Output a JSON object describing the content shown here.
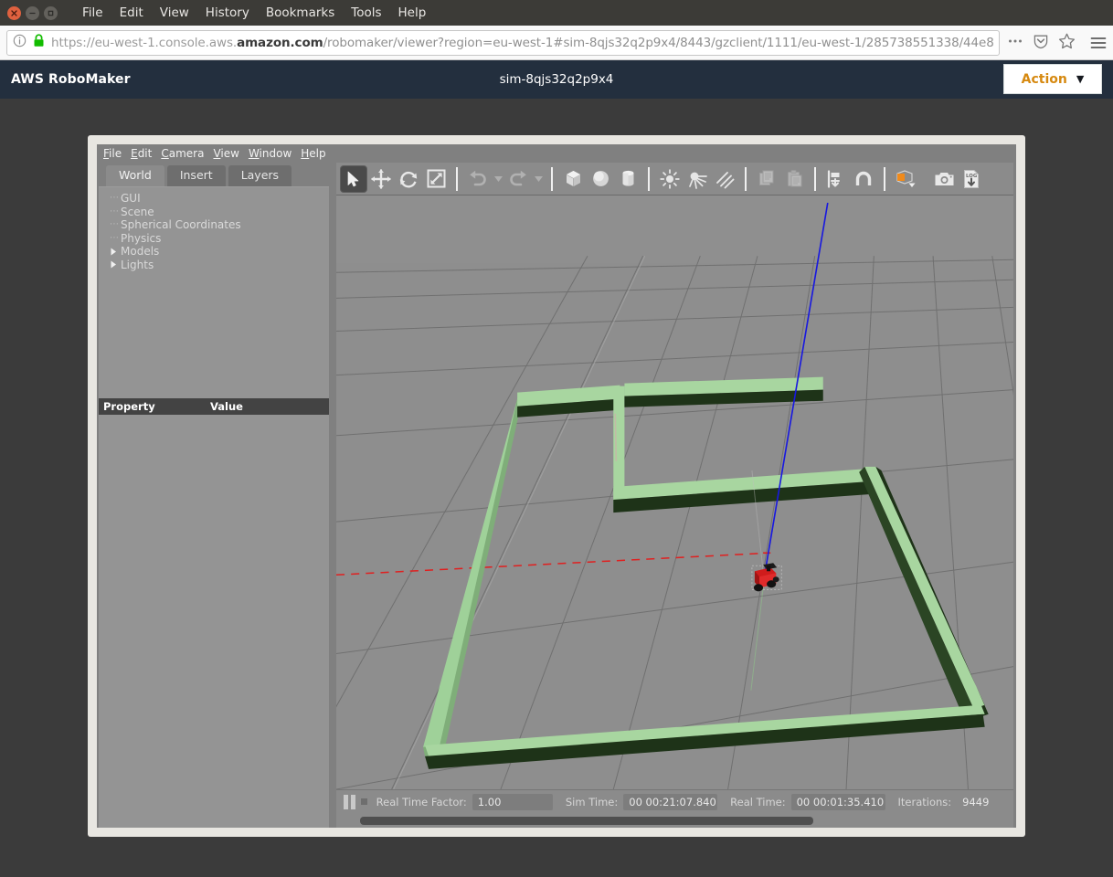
{
  "browser": {
    "window_controls": [
      "close",
      "minimize",
      "maximize"
    ],
    "menu": [
      "File",
      "Edit",
      "View",
      "History",
      "Bookmarks",
      "Tools",
      "Help"
    ],
    "url": {
      "scheme": "https://eu-west-1.console.aws.",
      "domain": "amazon.com",
      "path": "/robomaker/viewer?region=eu-west-1#sim-8qjs32q2p9x4/8443/gzclient/1111/eu-west-1/285738551338/44e8",
      "security_icon": "lock-icon",
      "info_icon": "info-icon"
    },
    "nav_icons": [
      "overflow-menu-icon",
      "pocket-icon",
      "bookmark-star-icon",
      "hamburger-menu-icon"
    ]
  },
  "aws": {
    "logo": "AWS RoboMaker",
    "simulation_name": "sim-8qjs32q2p9x4",
    "action_button": {
      "label": "Action",
      "caret": "▼"
    },
    "header_color": "#232f3e",
    "action_label_color": "#d68910"
  },
  "gazebo": {
    "menu": [
      {
        "label": "File",
        "mnemonic": "F"
      },
      {
        "label": "Edit",
        "mnemonic": "E"
      },
      {
        "label": "Camera",
        "mnemonic": "C"
      },
      {
        "label": "View",
        "mnemonic": "V"
      },
      {
        "label": "Window",
        "mnemonic": "W"
      },
      {
        "label": "Help",
        "mnemonic": "H"
      }
    ],
    "tabs": [
      {
        "label": "World",
        "active": true
      },
      {
        "label": "Insert",
        "active": false
      },
      {
        "label": "Layers",
        "active": false
      }
    ],
    "world_tree": [
      {
        "label": "GUI",
        "expandable": false
      },
      {
        "label": "Scene",
        "expandable": false
      },
      {
        "label": "Spherical Coordinates",
        "expandable": false
      },
      {
        "label": "Physics",
        "expandable": false
      },
      {
        "label": "Models",
        "expandable": true
      },
      {
        "label": "Lights",
        "expandable": true
      }
    ],
    "property_table": {
      "headers": [
        "Property",
        "Value"
      ],
      "rows": []
    },
    "toolbar": [
      {
        "name": "select-mode-icon",
        "active": true
      },
      {
        "name": "translate-mode-icon",
        "active": false
      },
      {
        "name": "rotate-mode-icon",
        "active": false
      },
      {
        "name": "scale-mode-icon",
        "active": false
      },
      {
        "name": "undo-icon",
        "disabled": true
      },
      {
        "name": "redo-icon",
        "disabled": true
      },
      {
        "name": "insert-box-icon",
        "active": false
      },
      {
        "name": "insert-sphere-icon",
        "active": false
      },
      {
        "name": "insert-cylinder-icon",
        "active": false
      },
      {
        "name": "point-light-icon",
        "active": false
      },
      {
        "name": "spot-light-icon",
        "active": false
      },
      {
        "name": "directional-light-icon",
        "active": false
      },
      {
        "name": "copy-icon",
        "disabled": true
      },
      {
        "name": "paste-icon",
        "disabled": true
      },
      {
        "name": "align-icon",
        "active": false
      },
      {
        "name": "snap-icon",
        "active": false
      },
      {
        "name": "view-angle-icon",
        "active": false
      },
      {
        "name": "screenshot-icon",
        "active": false
      },
      {
        "name": "log-record-icon",
        "active": false
      }
    ],
    "status": {
      "pause_icon": "pause-icon",
      "step_icon": "step-icon",
      "real_time_factor_label": "Real Time Factor:",
      "real_time_factor_value": "1.00",
      "sim_time_label": "Sim Time:",
      "sim_time_value": "00 00:21:07.840",
      "real_time_label": "Real Time:",
      "real_time_value": "00 00:01:35.410",
      "iterations_label": "Iterations:",
      "iterations_value": "9449"
    },
    "scene": {
      "description": "3D Gazebo viewport showing a green maze on a grey grid ground plane with a small red robot at the center",
      "ground_color": "#8f8f8f",
      "sky_color": "#8f8f8f",
      "grid_line_color": "#6e6e6e",
      "wall_top_color": "#a8d6a0",
      "wall_face_color": "#1e3318",
      "robot_body_color": "#d01c1c",
      "robot_wheel_color": "#151515",
      "axis_z_color": "#1818e0",
      "axis_x_color": "#e01818"
    }
  }
}
